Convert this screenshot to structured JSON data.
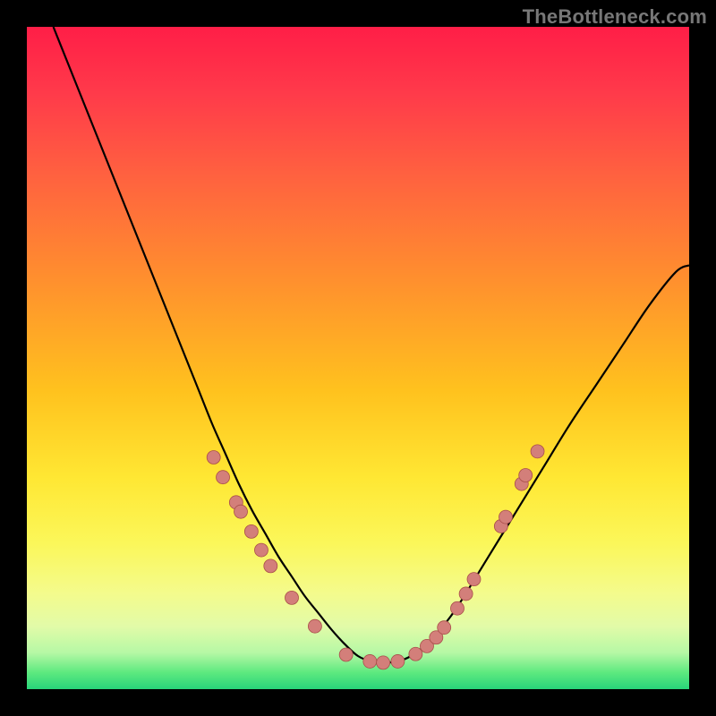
{
  "watermark": "TheBottleneck.com",
  "colors": {
    "black": "#000000",
    "curve": "#000000",
    "dot_fill": "#d37f7a",
    "dot_stroke": "#a94e4a",
    "gradient_stops": [
      {
        "offset": 0.0,
        "color": "#ff1e47"
      },
      {
        "offset": 0.1,
        "color": "#ff3a4a"
      },
      {
        "offset": 0.22,
        "color": "#ff6040"
      },
      {
        "offset": 0.38,
        "color": "#ff8f2e"
      },
      {
        "offset": 0.55,
        "color": "#ffc21e"
      },
      {
        "offset": 0.68,
        "color": "#ffe733"
      },
      {
        "offset": 0.78,
        "color": "#fbf75a"
      },
      {
        "offset": 0.855,
        "color": "#f4fb8c"
      },
      {
        "offset": 0.905,
        "color": "#e2fba8"
      },
      {
        "offset": 0.945,
        "color": "#b6f8a5"
      },
      {
        "offset": 0.975,
        "color": "#5de97f"
      },
      {
        "offset": 1.0,
        "color": "#28d47a"
      }
    ]
  },
  "chart_data": {
    "type": "line",
    "title": "",
    "xlabel": "",
    "ylabel": "",
    "xlim": [
      0,
      100
    ],
    "ylim": [
      0,
      100
    ],
    "grid": false,
    "series": [
      {
        "name": "curve",
        "x": [
          4,
          6,
          8,
          10,
          12,
          14,
          16,
          18,
          20,
          22,
          24,
          26,
          28,
          30,
          32,
          34,
          36,
          38,
          40,
          42,
          44,
          46,
          48,
          50,
          52,
          54,
          56,
          58,
          60,
          62,
          64,
          66,
          70,
          74,
          78,
          82,
          86,
          90,
          94,
          98,
          100
        ],
        "y": [
          100,
          95,
          90,
          85,
          80,
          75,
          70,
          65,
          60,
          55,
          50,
          45,
          40,
          35.5,
          31,
          27,
          23.5,
          20,
          17,
          14,
          11.5,
          9,
          6.8,
          5,
          4.2,
          4,
          4.2,
          5,
          6.5,
          8.5,
          11,
          14,
          20.5,
          27,
          33.5,
          40,
          46,
          52,
          58,
          63,
          64
        ]
      }
    ],
    "dots_left": [
      {
        "x": 28.2,
        "y": 35.0
      },
      {
        "x": 29.6,
        "y": 32.0
      },
      {
        "x": 31.6,
        "y": 28.2
      },
      {
        "x": 32.3,
        "y": 26.8
      },
      {
        "x": 33.9,
        "y": 23.8
      },
      {
        "x": 35.4,
        "y": 21.0
      },
      {
        "x": 36.8,
        "y": 18.6
      },
      {
        "x": 40.0,
        "y": 13.8
      },
      {
        "x": 43.5,
        "y": 9.5
      },
      {
        "x": 48.2,
        "y": 5.2
      },
      {
        "x": 51.8,
        "y": 4.2
      },
      {
        "x": 53.8,
        "y": 4.0
      }
    ],
    "dots_right": [
      {
        "x": 56.0,
        "y": 4.2
      },
      {
        "x": 58.7,
        "y": 5.3
      },
      {
        "x": 60.4,
        "y": 6.5
      },
      {
        "x": 61.8,
        "y": 7.8
      },
      {
        "x": 63.0,
        "y": 9.3
      },
      {
        "x": 65.0,
        "y": 12.2
      },
      {
        "x": 66.3,
        "y": 14.4
      },
      {
        "x": 67.5,
        "y": 16.6
      },
      {
        "x": 71.6,
        "y": 24.6
      },
      {
        "x": 72.3,
        "y": 26.0
      },
      {
        "x": 74.7,
        "y": 31.0
      },
      {
        "x": 75.3,
        "y": 32.3
      },
      {
        "x": 77.1,
        "y": 35.9
      }
    ]
  }
}
